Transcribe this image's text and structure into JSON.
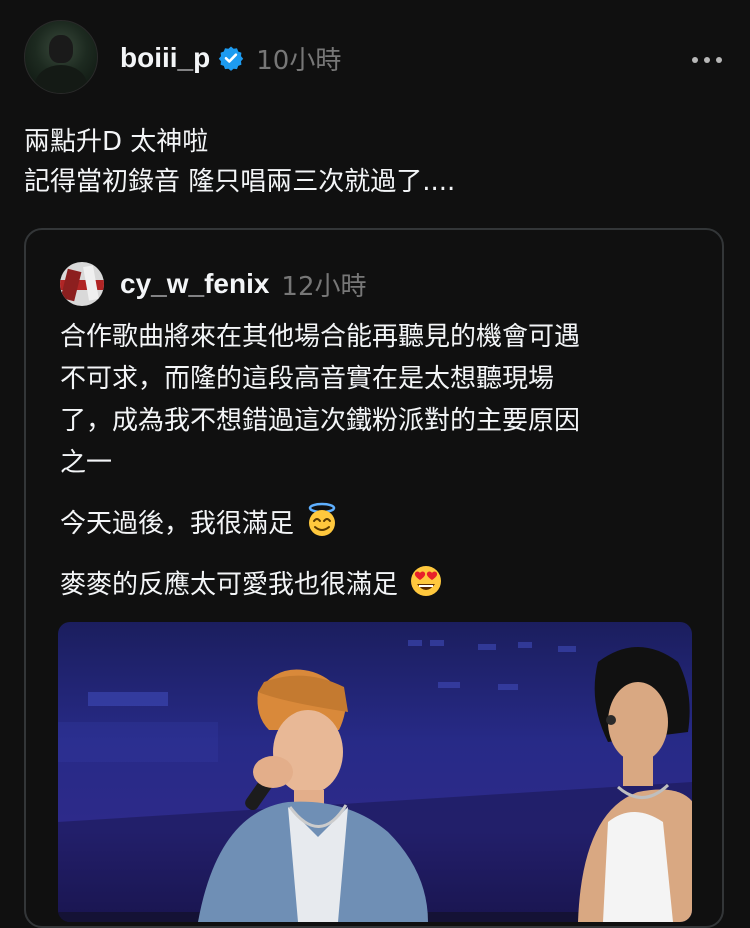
{
  "post": {
    "username": "boiii_p",
    "verified_icon": "verified-badge-icon",
    "timestamp": "10小時",
    "more_icon": "more-horizontal-icon",
    "text_lines": [
      "兩點升D 太神啦",
      "記得當初錄音 隆只唱兩三次就過了...."
    ]
  },
  "quoted_post": {
    "username": "cy_w_fenix",
    "timestamp": "12小時",
    "paragraph1_lines": [
      "合作歌曲將來在其他場合能再聽見的機會可遇",
      "不可求，而隆的這段高音實在是太想聽現場",
      "了，成為我不想錯過這次鐵粉派對的主要原因",
      "之一"
    ],
    "paragraph2": "今天過後，我很滿足",
    "paragraph2_emoji": "smiling-face-with-halo-emoji",
    "paragraph3": "麥麥的反應太可愛我也很滿足",
    "paragraph3_emoji": "heart-eyes-emoji",
    "media": "concert-photo-two-singers-on-stage"
  },
  "colors": {
    "background": "#101010",
    "text_primary": "#f3f5f7",
    "text_secondary": "#777777",
    "verified_blue": "#1d9bf0",
    "card_border": "#333638"
  }
}
